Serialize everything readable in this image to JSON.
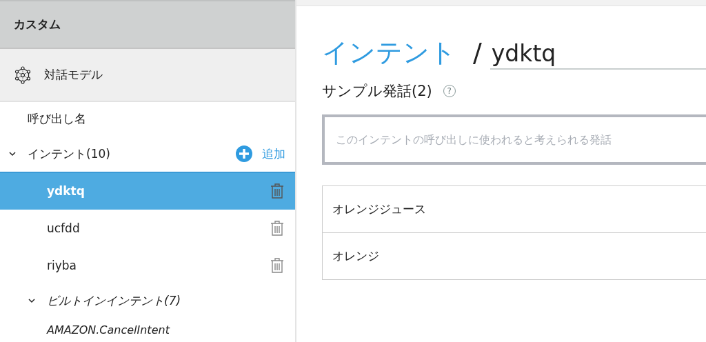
{
  "sidebar": {
    "header": "カスタム",
    "model_item": {
      "label": "対話モデル"
    },
    "invocation_item": {
      "label": "呼び出し名"
    },
    "intents": {
      "label": "インテント(10)",
      "expanded": true,
      "add_label": "追加",
      "items": [
        {
          "label": "ydktq",
          "selected": true
        },
        {
          "label": "ucfdd",
          "selected": false
        },
        {
          "label": "riyba",
          "selected": false
        }
      ]
    },
    "builtin": {
      "label": "ビルトインインテント(7)",
      "expanded": true,
      "items": [
        {
          "label": "AMAZON.CancelIntent",
          "selected": false
        }
      ]
    }
  },
  "main": {
    "breadcrumb": "インテント",
    "separator": "/",
    "intent_name": "ydktq",
    "section_title": "サンプル発話(2)",
    "help_icon": "?",
    "utterance_input": {
      "placeholder": "このインテントの呼び出しに使われると考えられる発話"
    },
    "utterances": [
      "オレンジジュース",
      "オレンジ"
    ]
  }
}
